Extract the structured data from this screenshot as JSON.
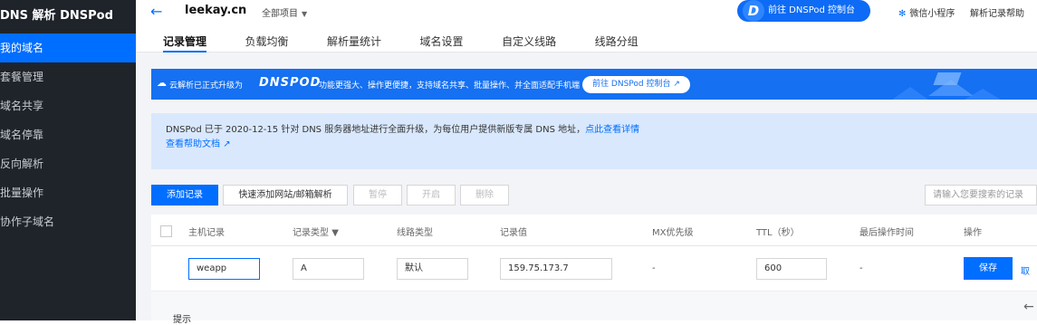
{
  "sidebar": {
    "brand": "DNS 解析 DNSPod",
    "items": [
      {
        "label": "我的域名",
        "active": true
      },
      {
        "label": "套餐管理",
        "active": false
      },
      {
        "label": "域名共享",
        "active": false
      },
      {
        "label": "域名停靠",
        "active": false
      },
      {
        "label": "反向解析",
        "active": false
      },
      {
        "label": "批量操作",
        "active": false
      },
      {
        "label": "协作子域名",
        "active": false
      }
    ]
  },
  "header": {
    "back_icon": "arrow-left-icon",
    "domain": "leekay.cn",
    "project": "全部项目",
    "cta_logo": "D",
    "cta_label": "前往 DNSPod 控制台",
    "miniprogram": "微信小程序",
    "help": "解析记录帮助"
  },
  "tabs": [
    {
      "label": "记录管理",
      "active": true
    },
    {
      "label": "负载均衡",
      "active": false
    },
    {
      "label": "解析量统计",
      "active": false
    },
    {
      "label": "域名设置",
      "active": false
    },
    {
      "label": "自定义线路",
      "active": false
    },
    {
      "label": "线路分组",
      "active": false
    }
  ],
  "banner": {
    "text1": "云解析已正式升级为",
    "logo": "DNSPOD",
    "text2": "功能更强大、操作更便捷，支持域名共享、批量操作、并全面适配手机端",
    "button": "前往 DNSPod 控制台",
    "color": "#1570f2"
  },
  "notice": {
    "text": "DNSPod 已于 2020-12-15 针对 DNS 服务器地址进行全面升级，为每位用户提供新版专属 DNS 地址，",
    "link": "点此查看详情",
    "help_link": "查看帮助文档"
  },
  "toolbar": {
    "add": "添加记录",
    "quick_add": "快速添加网站/邮箱解析",
    "pause": "暂停",
    "enable": "开启",
    "delete": "删除",
    "search_placeholder": "请输入您要搜索的记录"
  },
  "table": {
    "headers": [
      "主机记录",
      "记录类型",
      "线路类型",
      "记录值",
      "MX优先级",
      "TTL（秒）",
      "最后操作时间",
      "操作"
    ],
    "row": {
      "host": "weapp",
      "type": "A",
      "line": "默认",
      "value": "159.75.173.7",
      "mx": "-",
      "ttl": "600",
      "last_op": "-",
      "save": "保存",
      "cancel": "取"
    },
    "hint": "提示"
  },
  "colors": {
    "accent": "#006eff",
    "sidebar_bg": "#1f242b"
  }
}
